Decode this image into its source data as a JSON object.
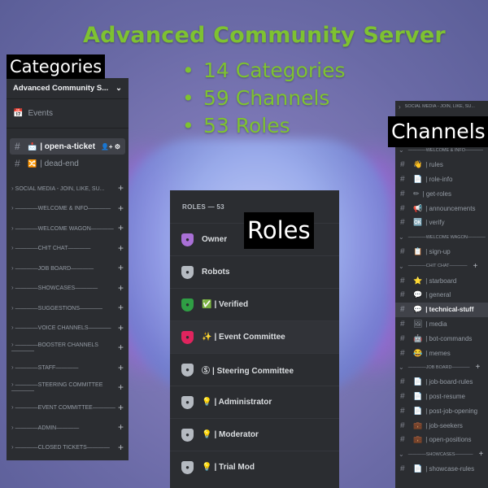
{
  "headline": "Advanced Community Server",
  "bullets": [
    {
      "dot": "•",
      "text": "14 Categories"
    },
    {
      "dot": "•",
      "text": "59 Channels"
    },
    {
      "dot": "•",
      "text": "53 Roles"
    }
  ],
  "labels": {
    "categories": "Categories",
    "roles": "Roles",
    "channels": "Channels"
  },
  "categories_panel": {
    "server_name": "Advanced Community S...",
    "events_label": "Events",
    "channels": [
      {
        "icon": "📩",
        "name": "| open-a-ticket",
        "active": true
      },
      {
        "icon": "🔀",
        "name": "| dead-end",
        "active": false
      }
    ],
    "categories": [
      "SOCIAL MEDIA - JOIN, LIKE, SU...",
      "————WELCOME & INFO————",
      "————WELCOME WAGON————",
      "————CHIT CHAT————",
      "————JOB BOARD————",
      "————SHOWCASES————",
      "————SUGGESTIONS————",
      "————VOICE CHANNELS————",
      "————BOOSTER CHANNELS————",
      "————STAFF————",
      "————STEERING COMMITTEE————",
      "————EVENT COMMITTEE————",
      "————ADMIN————",
      "————CLOSED TICKETS————"
    ]
  },
  "roles_panel": {
    "title": "ROLES — 53",
    "roles": [
      {
        "prefix": "",
        "name": "Owner",
        "color": "#a970d6"
      },
      {
        "prefix": "",
        "name": "Robots",
        "color": "#b5bac1"
      },
      {
        "prefix": "✅",
        "name": "| Verified",
        "color": "#2f9e44"
      },
      {
        "prefix": "✨",
        "name": "| Event Committee",
        "color": "#e0245e"
      },
      {
        "prefix": "Ⓢ",
        "name": "| Steering Committee",
        "color": "#b5bac1"
      },
      {
        "prefix": "💡",
        "name": "| Administrator",
        "color": "#b5bac1"
      },
      {
        "prefix": "💡",
        "name": "| Moderator",
        "color": "#b5bac1"
      },
      {
        "prefix": "💡",
        "name": "| Trial Mod",
        "color": "#b5bac1"
      }
    ]
  },
  "channels_panel": {
    "top_category": "SOCIAL MEDIA - JOIN, LIKE, SU...",
    "groups": [
      {
        "category": "————WELCOME & INFO————",
        "channels": [
          {
            "icon": "👋",
            "name": "| rules"
          },
          {
            "icon": "📄",
            "name": "| role-info"
          },
          {
            "icon": "✏",
            "name": "| get-roles"
          },
          {
            "icon": "📢",
            "name": "| announcements"
          },
          {
            "icon": "🆗",
            "name": "| verify"
          }
        ]
      },
      {
        "category": "————WELCOME WAGON————",
        "channels": [
          {
            "icon": "📋",
            "name": "| sign-up"
          }
        ]
      },
      {
        "category": "————CHIT CHAT————",
        "channels": [
          {
            "icon": "⭐",
            "name": "| starboard"
          },
          {
            "icon": "💬",
            "name": "| general"
          },
          {
            "icon": "💬",
            "name": "| technical-stuff",
            "active": true
          },
          {
            "icon": "🖼",
            "name": "| media"
          },
          {
            "icon": "🤖",
            "name": "| bot-commands"
          },
          {
            "icon": "😂",
            "name": "| memes"
          }
        ]
      },
      {
        "category": "————JOB BOARD————",
        "channels": [
          {
            "icon": "📄",
            "name": "| job-board-rules"
          },
          {
            "icon": "📄",
            "name": "| post-resume"
          },
          {
            "icon": "📄",
            "name": "| post-job-opening"
          },
          {
            "icon": "💼",
            "name": "| job-seekers"
          },
          {
            "icon": "💼",
            "name": "| open-positions"
          }
        ]
      },
      {
        "category": "————SHOWCASES————",
        "channels": [
          {
            "icon": "📄",
            "name": "| showcase-rules"
          }
        ]
      }
    ]
  }
}
